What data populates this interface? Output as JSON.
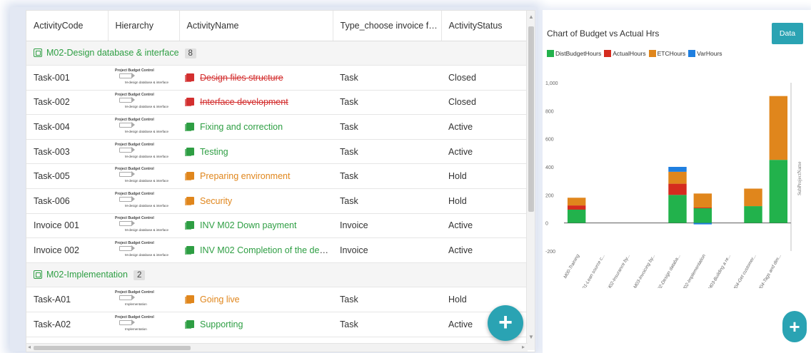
{
  "grid": {
    "columns": [
      "ActivityCode",
      "Hierarchy",
      "ActivityName",
      "Type_choose invoice for ...",
      "ActivityStatus"
    ],
    "groups": [
      {
        "title": "M02-Design database & interface",
        "count": "8",
        "rows": [
          {
            "code": "Task-001",
            "hier_top": "Project Budget Control",
            "hier_bottom": "M-design database & interface",
            "name": "Design files structure",
            "status_class": "closed",
            "icon_color": "#d32f2f",
            "type": "Task",
            "status": "Closed"
          },
          {
            "code": "Task-002",
            "hier_top": "Project Budget Control",
            "hier_bottom": "M-design database & interface",
            "name": "Interface development",
            "status_class": "closed",
            "icon_color": "#d32f2f",
            "type": "Task",
            "status": "Closed"
          },
          {
            "code": "Task-004",
            "hier_top": "Project Budget Control",
            "hier_bottom": "M-design database & interface",
            "name": "Fixing and correction",
            "status_class": "active",
            "icon_color": "#2e9e43",
            "type": "Task",
            "status": "Active"
          },
          {
            "code": "Task-003",
            "hier_top": "Project Budget Control",
            "hier_bottom": "M-design database & interface",
            "name": "Testing",
            "status_class": "active",
            "icon_color": "#2e9e43",
            "type": "Task",
            "status": "Active"
          },
          {
            "code": "Task-005",
            "hier_top": "Project Budget Control",
            "hier_bottom": "M-design database & interface",
            "name": "Preparing environment",
            "status_class": "hold",
            "icon_color": "#e0861c",
            "type": "Task",
            "status": "Hold"
          },
          {
            "code": "Task-006",
            "hier_top": "Project Budget Control",
            "hier_bottom": "M-design database & interface",
            "name": "Security",
            "status_class": "hold",
            "icon_color": "#e0861c",
            "type": "Task",
            "status": "Hold"
          },
          {
            "code": "Invoice 001",
            "hier_top": "Project Budget Control",
            "hier_bottom": "M-design database & interface",
            "name": "INV M02 Down payment",
            "status_class": "active",
            "icon_color": "#2e9e43",
            "type": "Invoice",
            "status": "Active"
          },
          {
            "code": "Invoice 002",
            "hier_top": "Project Budget Control",
            "hier_bottom": "M-design database & interface",
            "name": "INV M02 Completion of the desi...",
            "status_class": "active",
            "icon_color": "#2e9e43",
            "type": "Invoice",
            "status": "Active"
          }
        ]
      },
      {
        "title": "M02-Implementation",
        "count": "2",
        "rows": [
          {
            "code": "Task-A01",
            "hier_top": "Project Budget Control",
            "hier_bottom": "Implementation",
            "name": "Going live",
            "status_class": "hold",
            "icon_color": "#e0861c",
            "type": "Task",
            "status": "Hold"
          },
          {
            "code": "Task-A02",
            "hier_top": "Project Budget Control",
            "hier_bottom": "Implementation",
            "name": "Supporting",
            "status_class": "active",
            "icon_color": "#2e9e43",
            "type": "Task",
            "status": "Active"
          }
        ]
      }
    ],
    "add_button_label": "+"
  },
  "chart_panel": {
    "data_button_label": "Data",
    "add_button_label": "+"
  },
  "chart_data": {
    "type": "bar",
    "stacked": true,
    "title": "Chart of Budget vs Actual Hrs",
    "xlabel": "",
    "ylabel": "",
    "right_axis_label": "SubProjectName",
    "ylim": [
      -200,
      1000
    ],
    "yticks": [
      "1,000",
      "800",
      "600",
      "400",
      "200",
      "0",
      "-200"
    ],
    "ytick_values": [
      1000,
      800,
      600,
      400,
      200,
      0,
      -200
    ],
    "categories": [
      "M00-Training",
      "M01-Lean source c...",
      "M02-Insurance by...",
      "M03-Invoicing by...",
      "M02-Design databa...",
      "M02-Implementation",
      "M03-Building a re...",
      "M04-Get customer...",
      "M04-Tags and dim..."
    ],
    "series": [
      {
        "name": "DistBudgetHours",
        "color": "#22b24c",
        "values": [
          95,
          0,
          0,
          0,
          200,
          105,
          0,
          120,
          450
        ]
      },
      {
        "name": "ActualHours",
        "color": "#d52b1e",
        "values": [
          30,
          0,
          0,
          0,
          80,
          5,
          0,
          0,
          0
        ]
      },
      {
        "name": "ETCHours",
        "color": "#e0861c",
        "values": [
          55,
          0,
          0,
          0,
          85,
          100,
          0,
          125,
          455
        ]
      },
      {
        "name": "VarHours",
        "color": "#1f7fe0",
        "values": [
          0,
          0,
          0,
          0,
          35,
          -10,
          0,
          0,
          0
        ]
      }
    ]
  }
}
